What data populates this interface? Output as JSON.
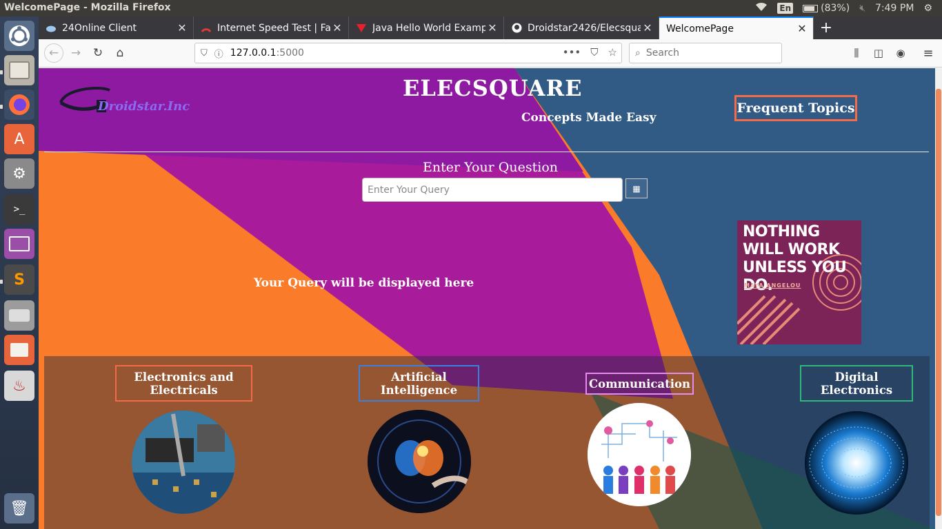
{
  "system": {
    "window_title": "WelcomePage - Mozilla Firefox",
    "keyboard_layout": "En",
    "battery": "(83%)",
    "clock": "7:49 PM"
  },
  "launcher": {
    "items": [
      "ubuntu-dash",
      "files",
      "firefox",
      "software-center",
      "system-settings",
      "terminal",
      "workspaces",
      "sublime-text",
      "disks",
      "file-manager",
      "java",
      "trash"
    ]
  },
  "tabs": [
    {
      "label": "24Online Client",
      "icon": "cloud-icon"
    },
    {
      "label": "Internet Speed Test | Fa",
      "icon": "speedometer-icon"
    },
    {
      "label": "Java Hello World Examp",
      "icon": "v-logo-icon"
    },
    {
      "label": "Droidstar2426/Elecsqua",
      "icon": "github-icon"
    },
    {
      "label": "WelcomePage",
      "icon": ""
    }
  ],
  "nav": {
    "url_host": "127.0.0.1",
    "url_port": ":5000",
    "search_placeholder": "Search"
  },
  "page": {
    "logo_text": "Droidstar.Inc",
    "title": "ELECSQUARE",
    "tagline": "Concepts Made Easy",
    "frequent_topics": "Frequent Topics",
    "question_label": "Enter Your Question",
    "query_placeholder": "Enter Your Query",
    "query_display": "Your Query will be displayed here",
    "quote_text": "NOTHING WILL WORK UNLESS YOU DO.",
    "quote_author": "MAYA ANGELOU",
    "topics": [
      {
        "label": "Electronics and Electricals",
        "color": "#f56b4a"
      },
      {
        "label": "Artificial Intelligence",
        "color": "#3b7fe0"
      },
      {
        "label": "Communication",
        "color": "#e58cf2"
      },
      {
        "label": "Digital Electronics",
        "color": "#2fb87a"
      }
    ]
  },
  "colors": {
    "accent_orange": "#f56b4a",
    "bg_orange": "#fb8c2c",
    "bg_magenta": "#b3139c",
    "bg_blue": "#2e5d86",
    "quote_bg": "#7c2458"
  }
}
